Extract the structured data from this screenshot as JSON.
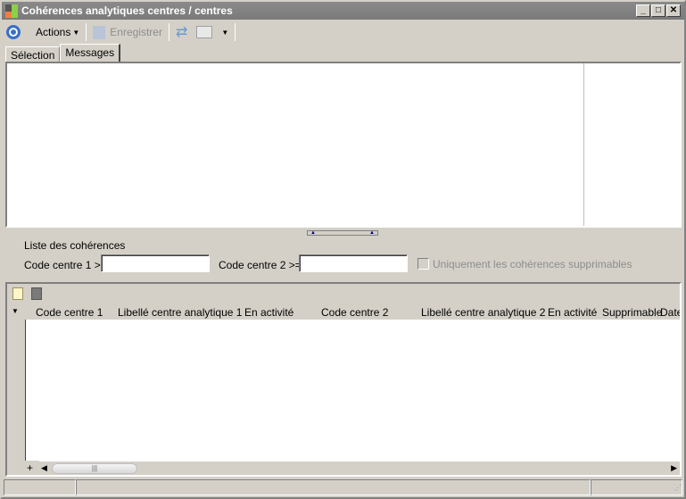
{
  "window": {
    "title": "Cohérences analytiques centres / centres",
    "minimize": "_",
    "maximize": "□",
    "close": "✕"
  },
  "toolbar": {
    "actions_label": "Actions",
    "save_label": "Enregistrer"
  },
  "tabs": [
    {
      "label": "Sélection",
      "active": false
    },
    {
      "label": "Messages",
      "active": true
    }
  ],
  "filters": {
    "section_title": "Liste des cohérences",
    "code1_label": "Code centre 1 >=",
    "code1_value": "",
    "code2_label": "Code centre 2  >=",
    "code2_value": "",
    "only_deletable_label": "Uniquement les cohérences supprimables",
    "only_deletable_checked": false
  },
  "grid": {
    "columns": [
      "Code centre 1",
      "Libellé centre analytique 1",
      "En activité",
      "Code centre 2",
      "Libellé centre analytique 2",
      "En activité",
      "Supprimable",
      "Date"
    ],
    "rows": [],
    "add_row": "+",
    "scroll_grip": "|||"
  },
  "colors": {
    "titlebar": "#808080",
    "face": "#d4d0c8",
    "accent": "#2a5db0"
  }
}
